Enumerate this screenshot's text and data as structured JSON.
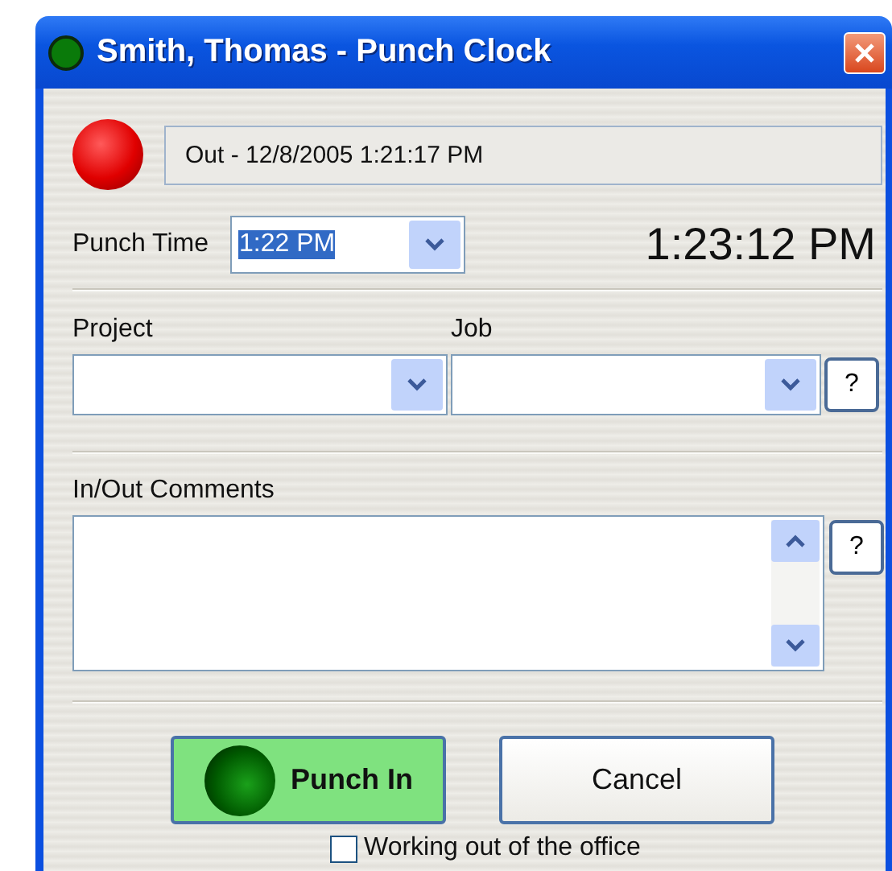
{
  "window": {
    "title": "Smith, Thomas - Punch Clock"
  },
  "status": {
    "punched_in": false,
    "text": "Out - 12/8/2005 1:21:17 PM"
  },
  "punch_time": {
    "label": "Punch Time",
    "value": "1:22 PM",
    "value_highlighted": true
  },
  "clock": "1:23:12 PM",
  "project": {
    "label": "Project"
  },
  "job": {
    "label": "Job",
    "help": "?"
  },
  "comments": {
    "label": "In/Out Comments",
    "help": "?"
  },
  "buttons": [
    {
      "kind": "punch",
      "label": "Punch In"
    },
    {
      "kind": "cancel",
      "label": "Cancel"
    }
  ],
  "working_out_of_office": {
    "label": "Working out of the office",
    "checked": false
  }
}
